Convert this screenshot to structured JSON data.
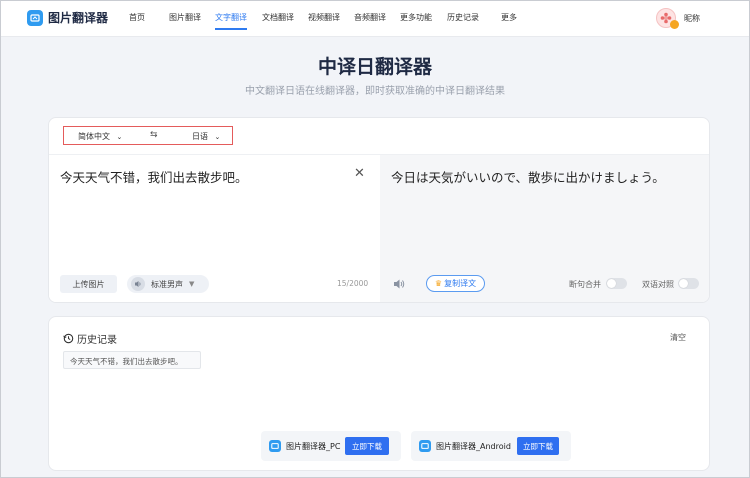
{
  "header": {
    "app_name": "图片翻译器",
    "nav": [
      "首页",
      "图片翻译",
      "文字翻译",
      "文档翻译",
      "视频翻译",
      "音频翻译",
      "更多功能",
      "历史记录",
      "更多"
    ],
    "active_nav": "文字翻译",
    "user_name": "昵称"
  },
  "page": {
    "title": "中译日翻译器",
    "subtitle": "中文翻译日语在线翻译器，即时获取准确的中译日翻译结果"
  },
  "translator": {
    "source_lang": "简体中文",
    "swap_symbol": "⇆",
    "target_lang": "日语",
    "source_text": "今天天气不错，我们出去散步吧。",
    "target_text": "今日は天気がいいので、散歩に出かけましょう。",
    "upload_label": "上传图片",
    "voice_label": "标准男声",
    "char_count": "15/2000",
    "copy_label": "复制译文",
    "toggle_sentence_merge": "断句合并",
    "toggle_bilingual": "双语对照"
  },
  "history": {
    "title": "历史记录",
    "clear_label": "清空",
    "items": [
      "今天天气不错，我们出去散步吧。"
    ]
  },
  "downloads": [
    {
      "name": "图片翻译器_PC",
      "button": "立即下载"
    },
    {
      "name": "图片翻译器_Android",
      "button": "立即下载"
    }
  ],
  "colors": {
    "accent": "#2f7bf0",
    "highlight_border": "#e45b5b"
  }
}
